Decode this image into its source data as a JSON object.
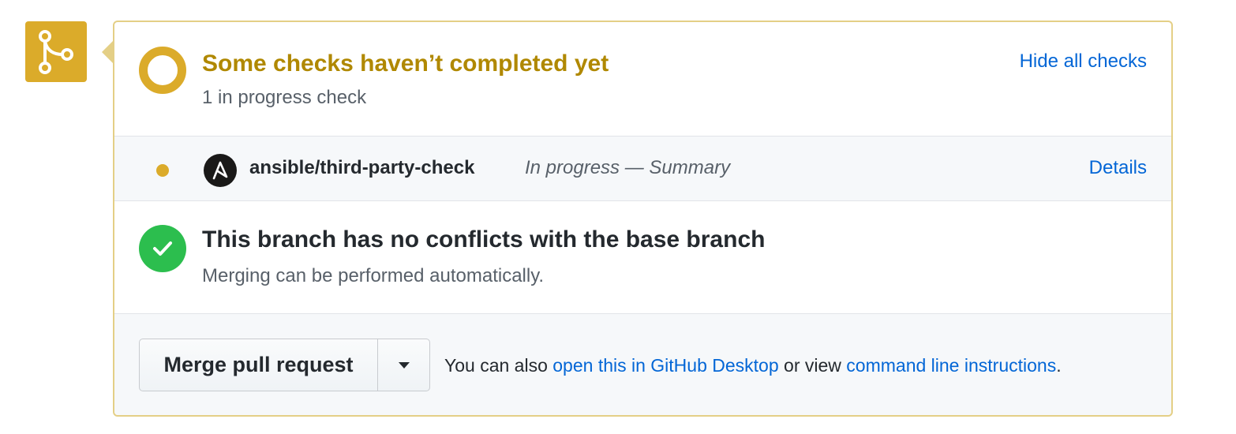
{
  "icons": {
    "merge": "git-merge-icon",
    "pending": "pending-ring-icon",
    "check_dot": "in-progress-dot-icon",
    "avatar": "ansible-logo-icon",
    "success": "check-icon",
    "caret": "caret-down-icon"
  },
  "colors": {
    "pending": "#dbab2a",
    "pending_text": "#b08800",
    "success": "#2cbe4e",
    "link": "#0366d6"
  },
  "status": {
    "title": "Some checks haven’t completed yet",
    "subtitle": "1 in progress check",
    "toggle_label": "Hide all checks"
  },
  "checks": [
    {
      "name": "ansible/third-party-check",
      "description": "In progress — Summary",
      "details_label": "Details"
    }
  ],
  "branch": {
    "title": "This branch has no conflicts with the base branch",
    "subtitle": "Merging can be performed automatically."
  },
  "merge": {
    "button_label": "Merge pull request",
    "text_prefix": "You can also ",
    "desktop_link": "open this in GitHub Desktop",
    "text_middle": " or view ",
    "cli_link": "command line instructions",
    "text_suffix": "."
  }
}
